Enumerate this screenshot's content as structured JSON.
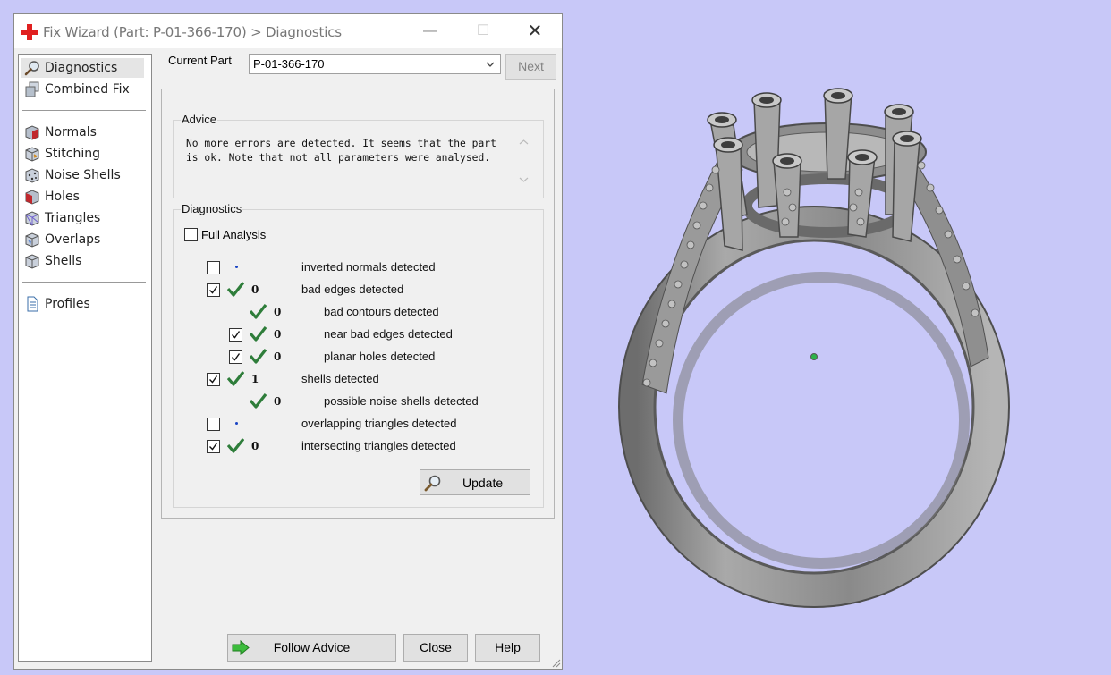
{
  "window": {
    "title": "Fix Wizard (Part: P-01-366-170) > Diagnostics",
    "minimize_glyph": "—",
    "maximize_glyph": "☐",
    "close_glyph": "✕"
  },
  "sidebar": {
    "items": [
      {
        "label": "Diagnostics",
        "icon": "magnifier-icon",
        "selected": true
      },
      {
        "label": "Combined Fix",
        "icon": "cube-stack-icon"
      },
      {
        "label": "Normals",
        "icon": "normals-cube-icon"
      },
      {
        "label": "Stitching",
        "icon": "stitching-cube-icon"
      },
      {
        "label": "Noise Shells",
        "icon": "noise-shells-icon"
      },
      {
        "label": "Holes",
        "icon": "holes-cube-icon"
      },
      {
        "label": "Triangles",
        "icon": "triangles-cube-icon"
      },
      {
        "label": "Overlaps",
        "icon": "overlaps-cube-icon"
      },
      {
        "label": "Shells",
        "icon": "shells-cube-icon"
      },
      {
        "label": "Profiles",
        "icon": "document-icon"
      }
    ]
  },
  "part": {
    "label": "Current Part",
    "value": "P-01-366-170",
    "next_label": "Next"
  },
  "advice": {
    "legend": "Advice",
    "text": "No more errors are detected. It seems that the part is ok. Note that not all parameters were analysed."
  },
  "diagnostics": {
    "legend": "Diagnostics",
    "full_analysis_label": "Full Analysis",
    "full_analysis_checked": false,
    "rows": [
      {
        "label": "inverted normals detected",
        "checked": false,
        "status": "dot",
        "count": "",
        "has_checkbox": true,
        "indent": 0
      },
      {
        "label": "bad edges detected",
        "checked": true,
        "status": "ok",
        "count": "0",
        "has_checkbox": true,
        "indent": 0
      },
      {
        "label": "bad contours detected",
        "checked": false,
        "status": "ok",
        "count": "0",
        "has_checkbox": false,
        "indent": 1
      },
      {
        "label": "near bad edges detected",
        "checked": true,
        "status": "ok",
        "count": "0",
        "has_checkbox": true,
        "indent": 1
      },
      {
        "label": "planar holes detected",
        "checked": true,
        "status": "ok",
        "count": "0",
        "has_checkbox": true,
        "indent": 1
      },
      {
        "label": "shells detected",
        "checked": true,
        "status": "ok",
        "count": "1",
        "has_checkbox": true,
        "indent": 0
      },
      {
        "label": "possible noise shells detected",
        "checked": false,
        "status": "ok",
        "count": "0",
        "has_checkbox": false,
        "indent": 1
      },
      {
        "label": "overlapping triangles detected",
        "checked": false,
        "status": "dot",
        "count": "",
        "has_checkbox": true,
        "indent": 0
      },
      {
        "label": "intersecting triangles detected",
        "checked": true,
        "status": "ok",
        "count": "0",
        "has_checkbox": true,
        "indent": 0
      }
    ],
    "update_label": "Update"
  },
  "footer": {
    "follow_advice_label": "Follow Advice",
    "close_label": "Close",
    "help_label": "Help"
  },
  "colors": {
    "viewport_bg": "#c8c8f8",
    "check_green": "#2e7d3a",
    "dot_blue": "#1a44c4"
  }
}
